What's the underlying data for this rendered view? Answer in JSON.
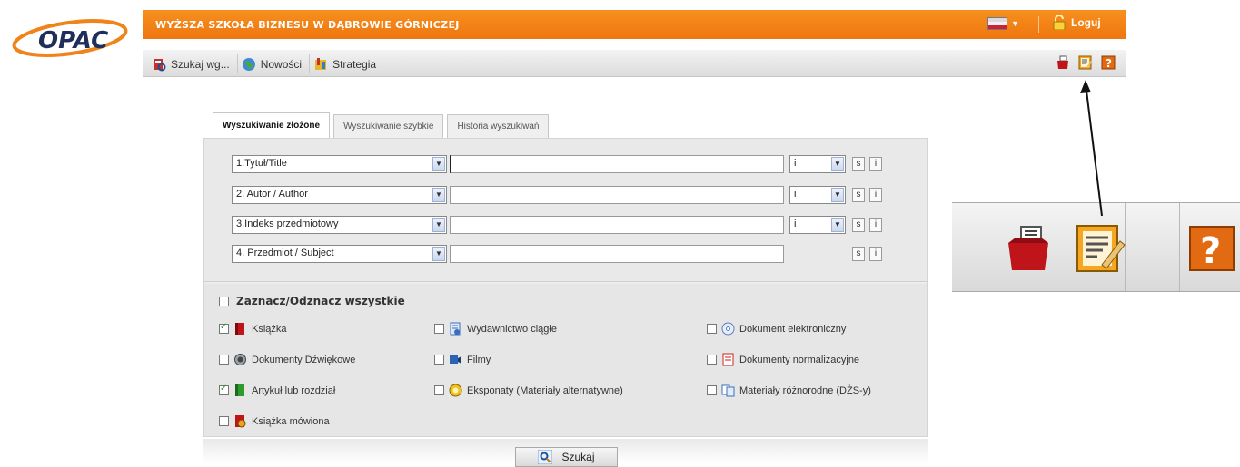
{
  "logo": {
    "text": "OPAC"
  },
  "header": {
    "org_name": "WYŻSZA SZKOŁA BIZNESU W DĄBROWIE GÓRNICZEJ",
    "login_label": "Loguj",
    "accent": "#f08319"
  },
  "nav": [
    {
      "label": "Szukaj wg...",
      "icon": "search-book-icon"
    },
    {
      "label": "Nowości",
      "icon": "globe-icon"
    },
    {
      "label": "Strategia",
      "icon": "strategy-icon"
    }
  ],
  "tools": [
    "basket-icon",
    "notepad-icon",
    "help-icon"
  ],
  "tabs": [
    "Wyszukiwanie złożone",
    "Wyszukiwanie szybkie",
    "Historia wyszukiwań"
  ],
  "fields": [
    {
      "select": "1.Tytuł/Title",
      "operator": "i",
      "s": "s",
      "i": "i"
    },
    {
      "select": "2. Autor / Author",
      "operator": "i",
      "s": "s",
      "i": "i"
    },
    {
      "select": "3.Indeks przedmiotowy",
      "operator": "i",
      "s": "s",
      "i": "i"
    },
    {
      "select": "4. Przedmiot / Subject",
      "s": "s",
      "i": "i"
    }
  ],
  "select_all": "Zaznacz/Odznacz wszystkie",
  "types": [
    {
      "label": "Książka",
      "checked": true,
      "icon": "book-icon"
    },
    {
      "label": "Wydawnictwo ciągłe",
      "checked": false,
      "icon": "periodical-icon"
    },
    {
      "label": "Dokument elektroniczny",
      "checked": false,
      "icon": "cd-icon"
    },
    {
      "label": "Dokumenty Dźwiękowe",
      "checked": false,
      "icon": "speaker-icon"
    },
    {
      "label": "Filmy",
      "checked": false,
      "icon": "film-icon"
    },
    {
      "label": "Dokumenty normalizacyjne",
      "checked": false,
      "icon": "norm-icon"
    },
    {
      "label": "Artykuł lub rozdział",
      "checked": true,
      "icon": "article-icon"
    },
    {
      "label": "Eksponaty (Materiały alternatywne)",
      "checked": false,
      "icon": "exhibit-icon"
    },
    {
      "label": "Materiały różnorodne (DŻS-y)",
      "checked": false,
      "icon": "mixed-icon"
    },
    {
      "label": "Książka mówiona",
      "checked": false,
      "icon": "audiobook-icon"
    }
  ],
  "search_button": "Szukaj"
}
